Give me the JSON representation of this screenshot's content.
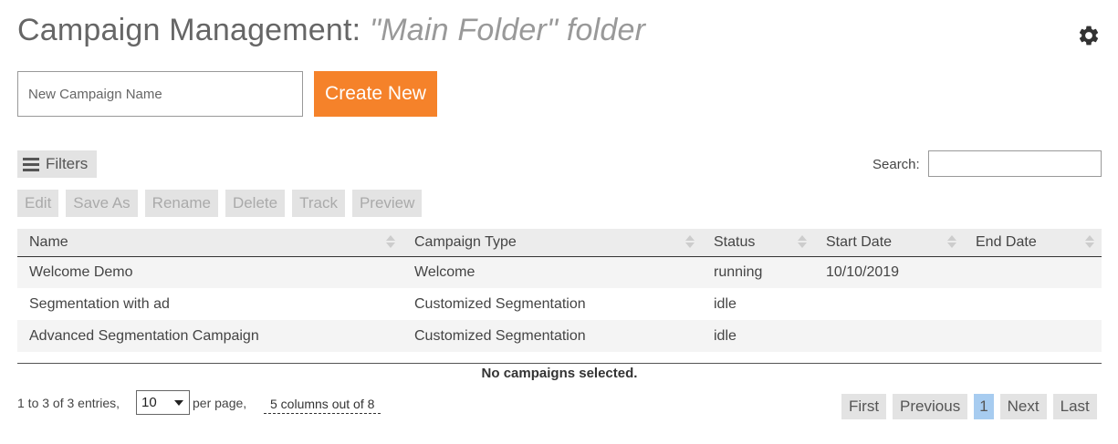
{
  "header": {
    "title": "Campaign Management:",
    "folder_label": "\"Main Folder\" folder"
  },
  "settings_icon": "gear-icon",
  "create": {
    "placeholder": "New Campaign Name",
    "value": "",
    "button_label": "Create New",
    "button_color": "#f5822a"
  },
  "filters": {
    "label": "Filters",
    "icon": "hamburger-icon"
  },
  "search": {
    "label": "Search:",
    "value": ""
  },
  "actions": [
    "Edit",
    "Save As",
    "Rename",
    "Delete",
    "Track",
    "Preview"
  ],
  "table": {
    "columns": [
      "Name",
      "Campaign Type",
      "Status",
      "Start Date",
      "End Date"
    ],
    "rows": [
      [
        "Welcome Demo",
        "Welcome",
        "running",
        "10/10/2019",
        ""
      ],
      [
        "Segmentation with ad",
        "Customized Segmentation",
        "idle",
        "",
        ""
      ],
      [
        "Advanced Segmentation Campaign",
        "Customized Segmentation",
        "idle",
        "",
        ""
      ]
    ]
  },
  "selection_info": "No campaigns selected.",
  "footer": {
    "entries": "1 to 3 of 3 entries,",
    "per_page_value": "10",
    "per_page_label": "per page,",
    "columns_toggle": "5 columns out of 8"
  },
  "pagination": {
    "first": "First",
    "previous": "Previous",
    "current": "1",
    "next": "Next",
    "last": "Last",
    "current_color": "#a7ccf0"
  }
}
